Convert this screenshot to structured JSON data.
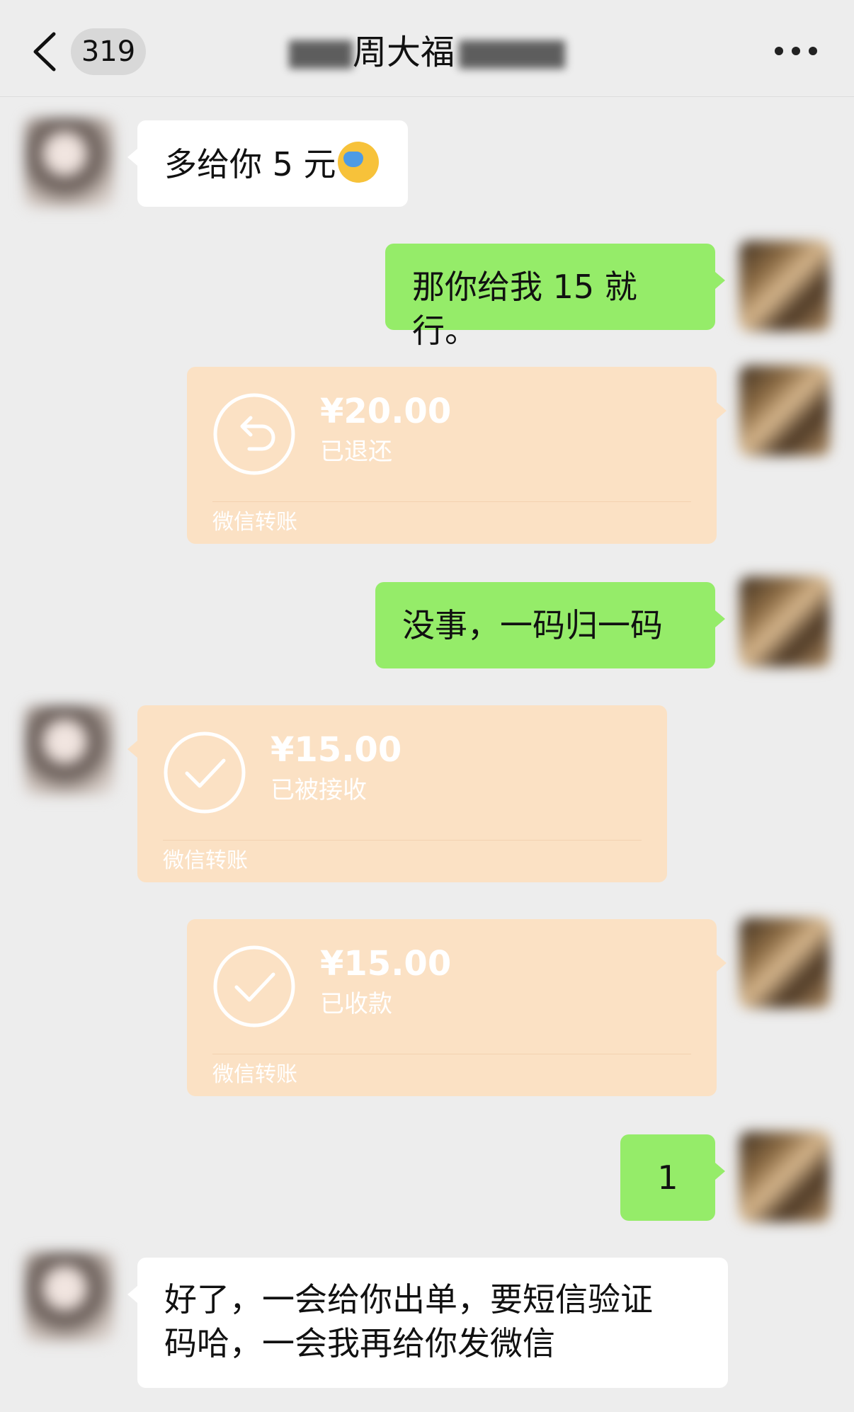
{
  "header": {
    "back_badge": "319",
    "title": "周大福"
  },
  "messages": [
    {
      "side": "peer",
      "type": "text",
      "text": "多给你 5 元"
    },
    {
      "side": "self",
      "type": "text",
      "text": "那你给我 15 就行。"
    },
    {
      "side": "self",
      "type": "transfer",
      "amount": "¥20.00",
      "status": "已退还",
      "footer": "微信转账",
      "icon": "return-icon"
    },
    {
      "side": "self",
      "type": "text",
      "text": "没事，一码归一码"
    },
    {
      "side": "peer",
      "type": "transfer",
      "amount": "¥15.00",
      "status": "已被接收",
      "footer": "微信转账",
      "icon": "check-circle-icon"
    },
    {
      "side": "self",
      "type": "transfer",
      "amount": "¥15.00",
      "status": "已收款",
      "footer": "微信转账",
      "icon": "check-circle-icon"
    },
    {
      "side": "self",
      "type": "text",
      "text": "1"
    },
    {
      "side": "peer",
      "type": "text",
      "lines": [
        "好了，一会给你出单，要短信验证",
        "码哈，一会我再给你发微信"
      ]
    }
  ],
  "colors": {
    "background": "#ededed",
    "self_bubble": "#95ec69",
    "peer_bubble": "#ffffff",
    "transfer_card": "#fbe1c4"
  }
}
